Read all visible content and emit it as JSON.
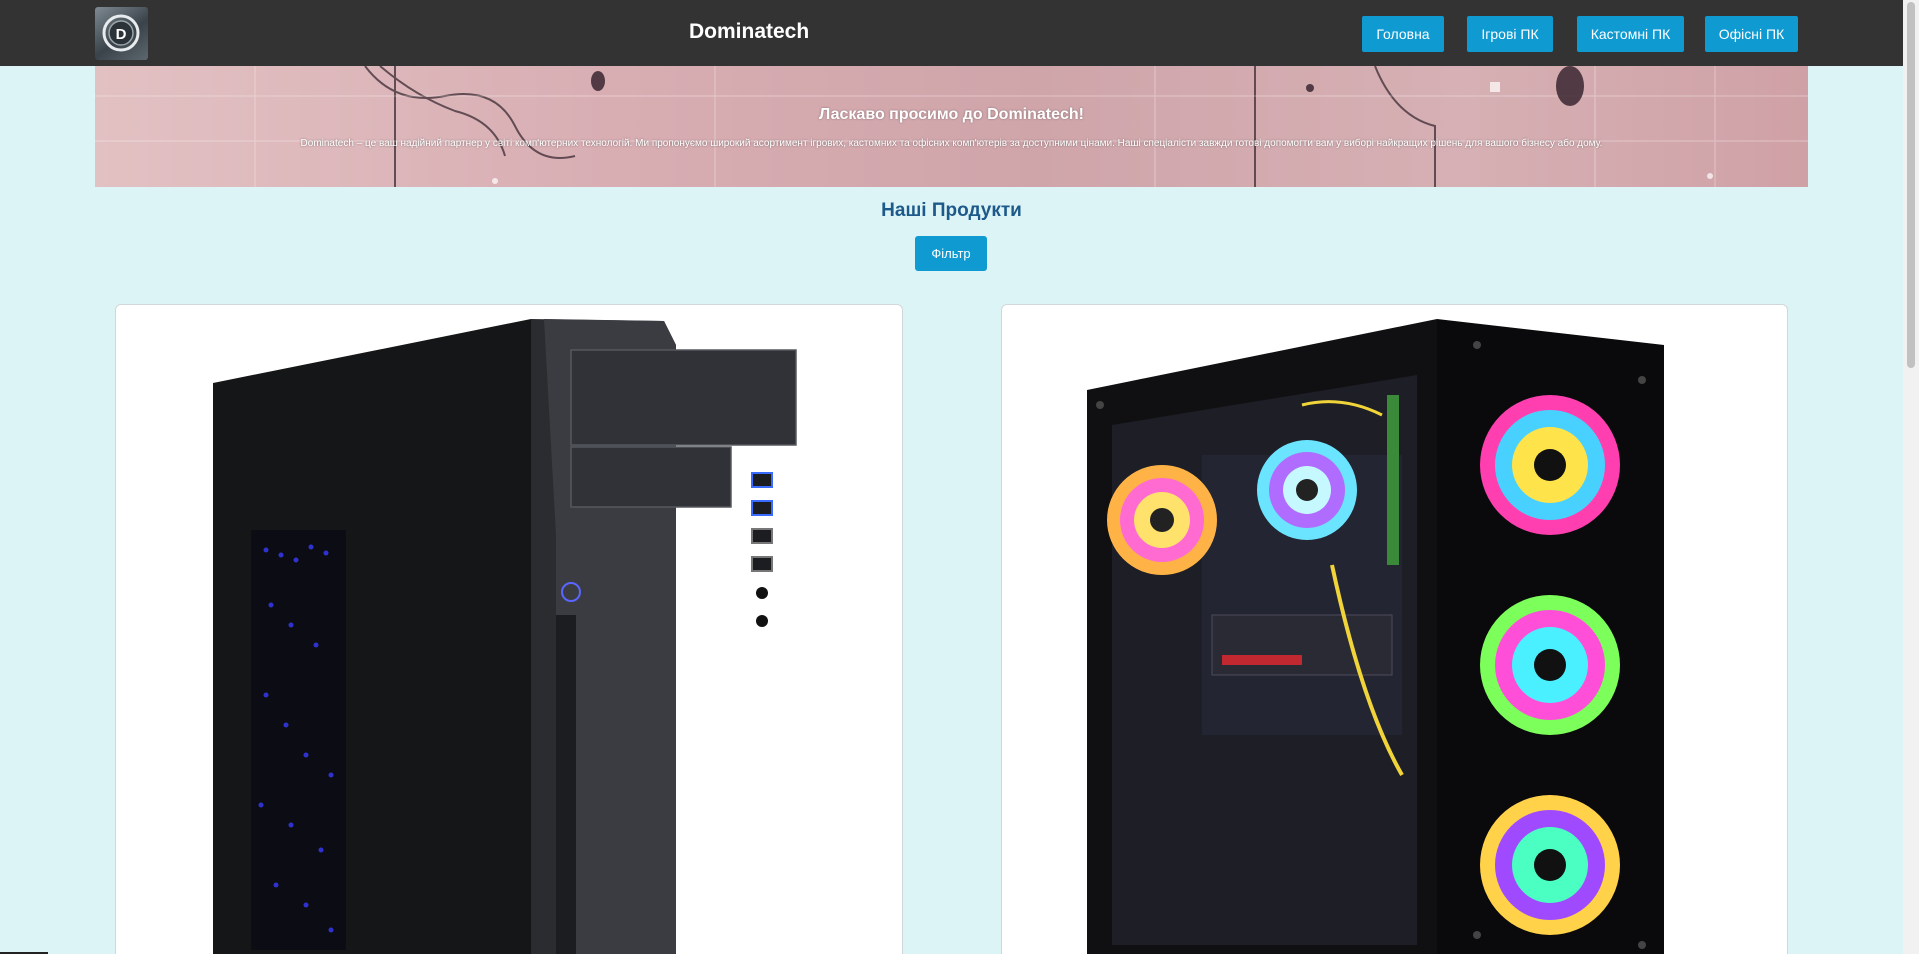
{
  "header": {
    "logo_letter": "D",
    "brand": "Dominatech",
    "nav": [
      {
        "label": "Головна"
      },
      {
        "label": "Ігрові ПК"
      },
      {
        "label": "Кастомні ПК"
      },
      {
        "label": "Офісні ПК"
      }
    ]
  },
  "hero": {
    "title": "Ласкаво просимо до Dominatech!",
    "text": "Dominatech – це ваш надійний партнер у світі комп'ютерних технологій. Ми пропонуємо широкий асортимент ігрових, кастомних та офісних комп'ютерів за доступними цінами. Наші спеціалісти завжди готові допомогти вам у виборі найкращих рішень для вашого бізнесу або дому."
  },
  "products": {
    "title": "Наші Продукти",
    "filter_label": "Фільтр"
  },
  "colors": {
    "header_bg": "#333333",
    "accent": "#0f9ad1",
    "page_bg": "#ddf4f7",
    "section_title": "#1d5a8a"
  }
}
